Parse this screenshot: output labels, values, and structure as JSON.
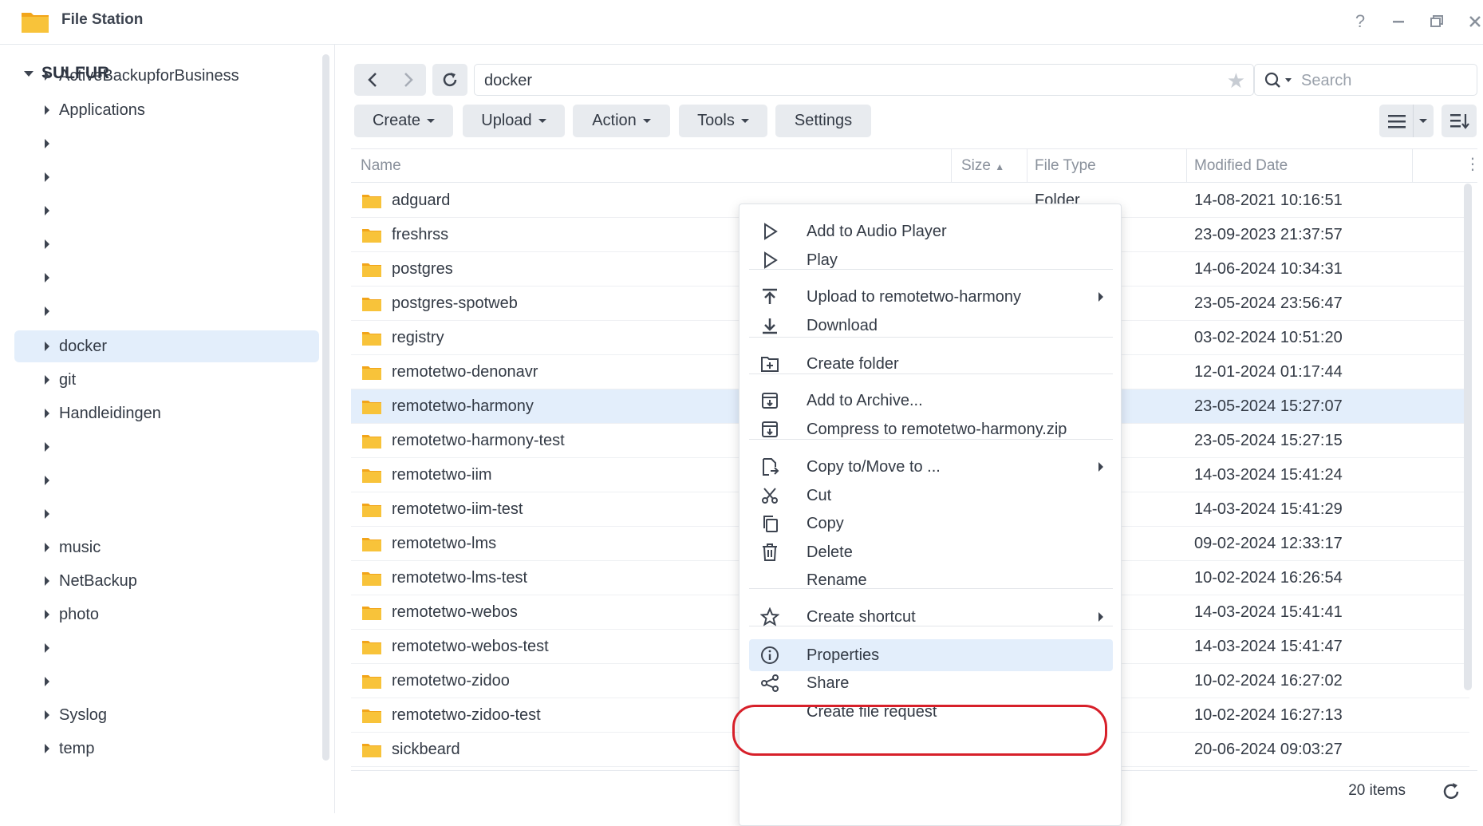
{
  "window": {
    "title": "File Station",
    "controls": [
      "help-icon",
      "minimize-icon",
      "restore-icon",
      "close-icon"
    ]
  },
  "sidebar": {
    "root": "SULFUR",
    "items": [
      {
        "label": "ActiveBackupforBusiness"
      },
      {
        "label": "Applications"
      },
      {
        "label": ""
      },
      {
        "label": ""
      },
      {
        "label": ""
      },
      {
        "label": ""
      },
      {
        "label": ""
      },
      {
        "label": ""
      },
      {
        "label": "docker",
        "selected": true
      },
      {
        "label": "git"
      },
      {
        "label": "Handleidingen"
      },
      {
        "label": ""
      },
      {
        "label": ""
      },
      {
        "label": ""
      },
      {
        "label": "music"
      },
      {
        "label": "NetBackup"
      },
      {
        "label": "photo"
      },
      {
        "label": ""
      },
      {
        "label": ""
      },
      {
        "label": "Syslog"
      },
      {
        "label": "temp"
      }
    ]
  },
  "toolbar": {
    "path": "docker",
    "search_placeholder": "Search",
    "buttons": {
      "create": "Create",
      "upload": "Upload",
      "action": "Action",
      "tools": "Tools",
      "settings": "Settings"
    }
  },
  "table": {
    "columns": {
      "name": "Name",
      "size": "Size",
      "type": "File Type",
      "modified": "Modified Date"
    },
    "rows": [
      {
        "name": "adguard",
        "type": "Folder",
        "modified": "14-08-2021 10:16:51"
      },
      {
        "name": "freshrss",
        "type": "",
        "modified": "23-09-2023 21:37:57"
      },
      {
        "name": "postgres",
        "type": "",
        "modified": "14-06-2024 10:34:31"
      },
      {
        "name": "postgres-spotweb",
        "type": "",
        "modified": "23-05-2024 23:56:47"
      },
      {
        "name": "registry",
        "type": "",
        "modified": "03-02-2024 10:51:20"
      },
      {
        "name": "remotetwo-denonavr",
        "type": "",
        "modified": "12-01-2024 01:17:44"
      },
      {
        "name": "remotetwo-harmony",
        "type": "",
        "modified": "23-05-2024 15:27:07",
        "selected": true
      },
      {
        "name": "remotetwo-harmony-test",
        "type": "",
        "modified": "23-05-2024 15:27:15"
      },
      {
        "name": "remotetwo-iim",
        "type": "",
        "modified": "14-03-2024 15:41:24"
      },
      {
        "name": "remotetwo-iim-test",
        "type": "",
        "modified": "14-03-2024 15:41:29"
      },
      {
        "name": "remotetwo-lms",
        "type": "",
        "modified": "09-02-2024 12:33:17"
      },
      {
        "name": "remotetwo-lms-test",
        "type": "",
        "modified": "10-02-2024 16:26:54"
      },
      {
        "name": "remotetwo-webos",
        "type": "",
        "modified": "14-03-2024 15:41:41"
      },
      {
        "name": "remotetwo-webos-test",
        "type": "",
        "modified": "14-03-2024 15:41:47"
      },
      {
        "name": "remotetwo-zidoo",
        "type": "",
        "modified": "10-02-2024 16:27:02"
      },
      {
        "name": "remotetwo-zidoo-test",
        "type": "",
        "modified": "10-02-2024 16:27:13"
      },
      {
        "name": "sickbeard",
        "type": "",
        "modified": "20-06-2024 09:03:27"
      }
    ],
    "item_count": "20 items"
  },
  "context_menu": {
    "items": [
      {
        "label": "Add to Audio Player",
        "icon": "play-icon"
      },
      {
        "label": "Play",
        "icon": "play-icon"
      },
      {
        "label": "Upload to remotetwo-harmony",
        "icon": "upload-icon",
        "submenu": true
      },
      {
        "label": "Download",
        "icon": "download-icon"
      },
      {
        "label": "Create folder",
        "icon": "new-folder-icon"
      },
      {
        "label": "Add to Archive...",
        "icon": "archive-icon"
      },
      {
        "label": "Compress to remotetwo-harmony.zip",
        "icon": "archive-icon"
      },
      {
        "label": "Copy to/Move to ...",
        "icon": "copy-move-icon",
        "submenu": true
      },
      {
        "label": "Cut",
        "icon": "scissors-icon"
      },
      {
        "label": "Copy",
        "icon": "copy-icon"
      },
      {
        "label": "Delete",
        "icon": "trash-icon"
      },
      {
        "label": "Rename",
        "icon": ""
      },
      {
        "label": "Create shortcut",
        "icon": "star-icon",
        "submenu": true
      },
      {
        "label": "Properties",
        "icon": "info-icon",
        "highlighted": true
      },
      {
        "label": "Share",
        "icon": "share-icon"
      },
      {
        "label": "Create file request",
        "icon": ""
      }
    ]
  },
  "colors": {
    "accent": "#0086e5",
    "selection": "#e3eefb",
    "folder": "#f8c33a",
    "annotation": "#d7202a"
  }
}
